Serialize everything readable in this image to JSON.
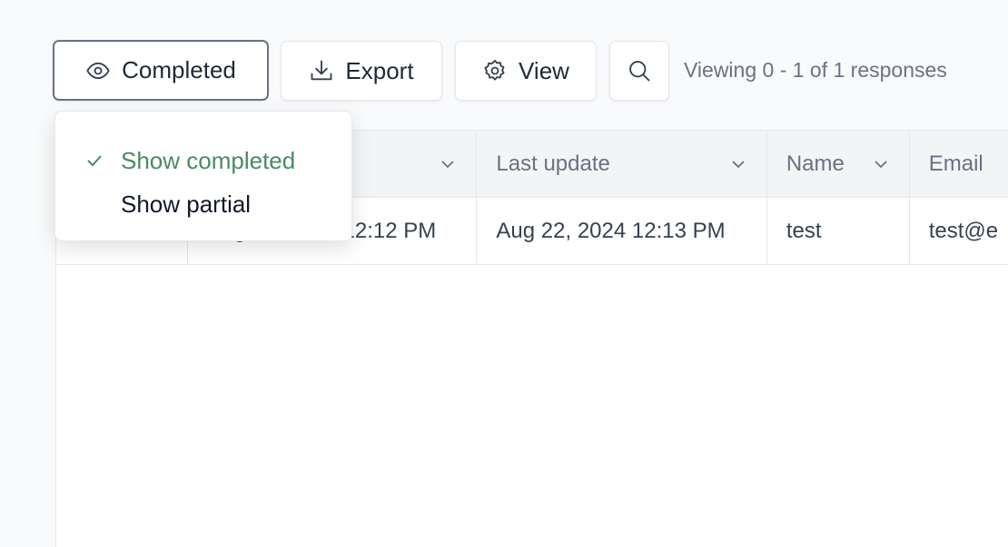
{
  "toolbar": {
    "filter_label": "Completed",
    "export_label": "Export",
    "view_label": "View",
    "status": "Viewing 0 - 1 of 1 responses",
    "icons": [
      "eye-icon",
      "download-icon",
      "gear-icon",
      "search-icon"
    ]
  },
  "filter_menu": {
    "items": [
      {
        "label": "Show completed",
        "selected": true
      },
      {
        "label": "Show partial",
        "selected": false
      }
    ],
    "accent_color": "#4a8a64"
  },
  "table": {
    "headers": [
      "",
      "",
      "Last update",
      "Name",
      "Email"
    ],
    "rows": [
      [
        "",
        "Aug 22, 2024 12:12 PM",
        "Aug 22, 2024 12:13 PM",
        "test",
        "test@e"
      ]
    ]
  }
}
